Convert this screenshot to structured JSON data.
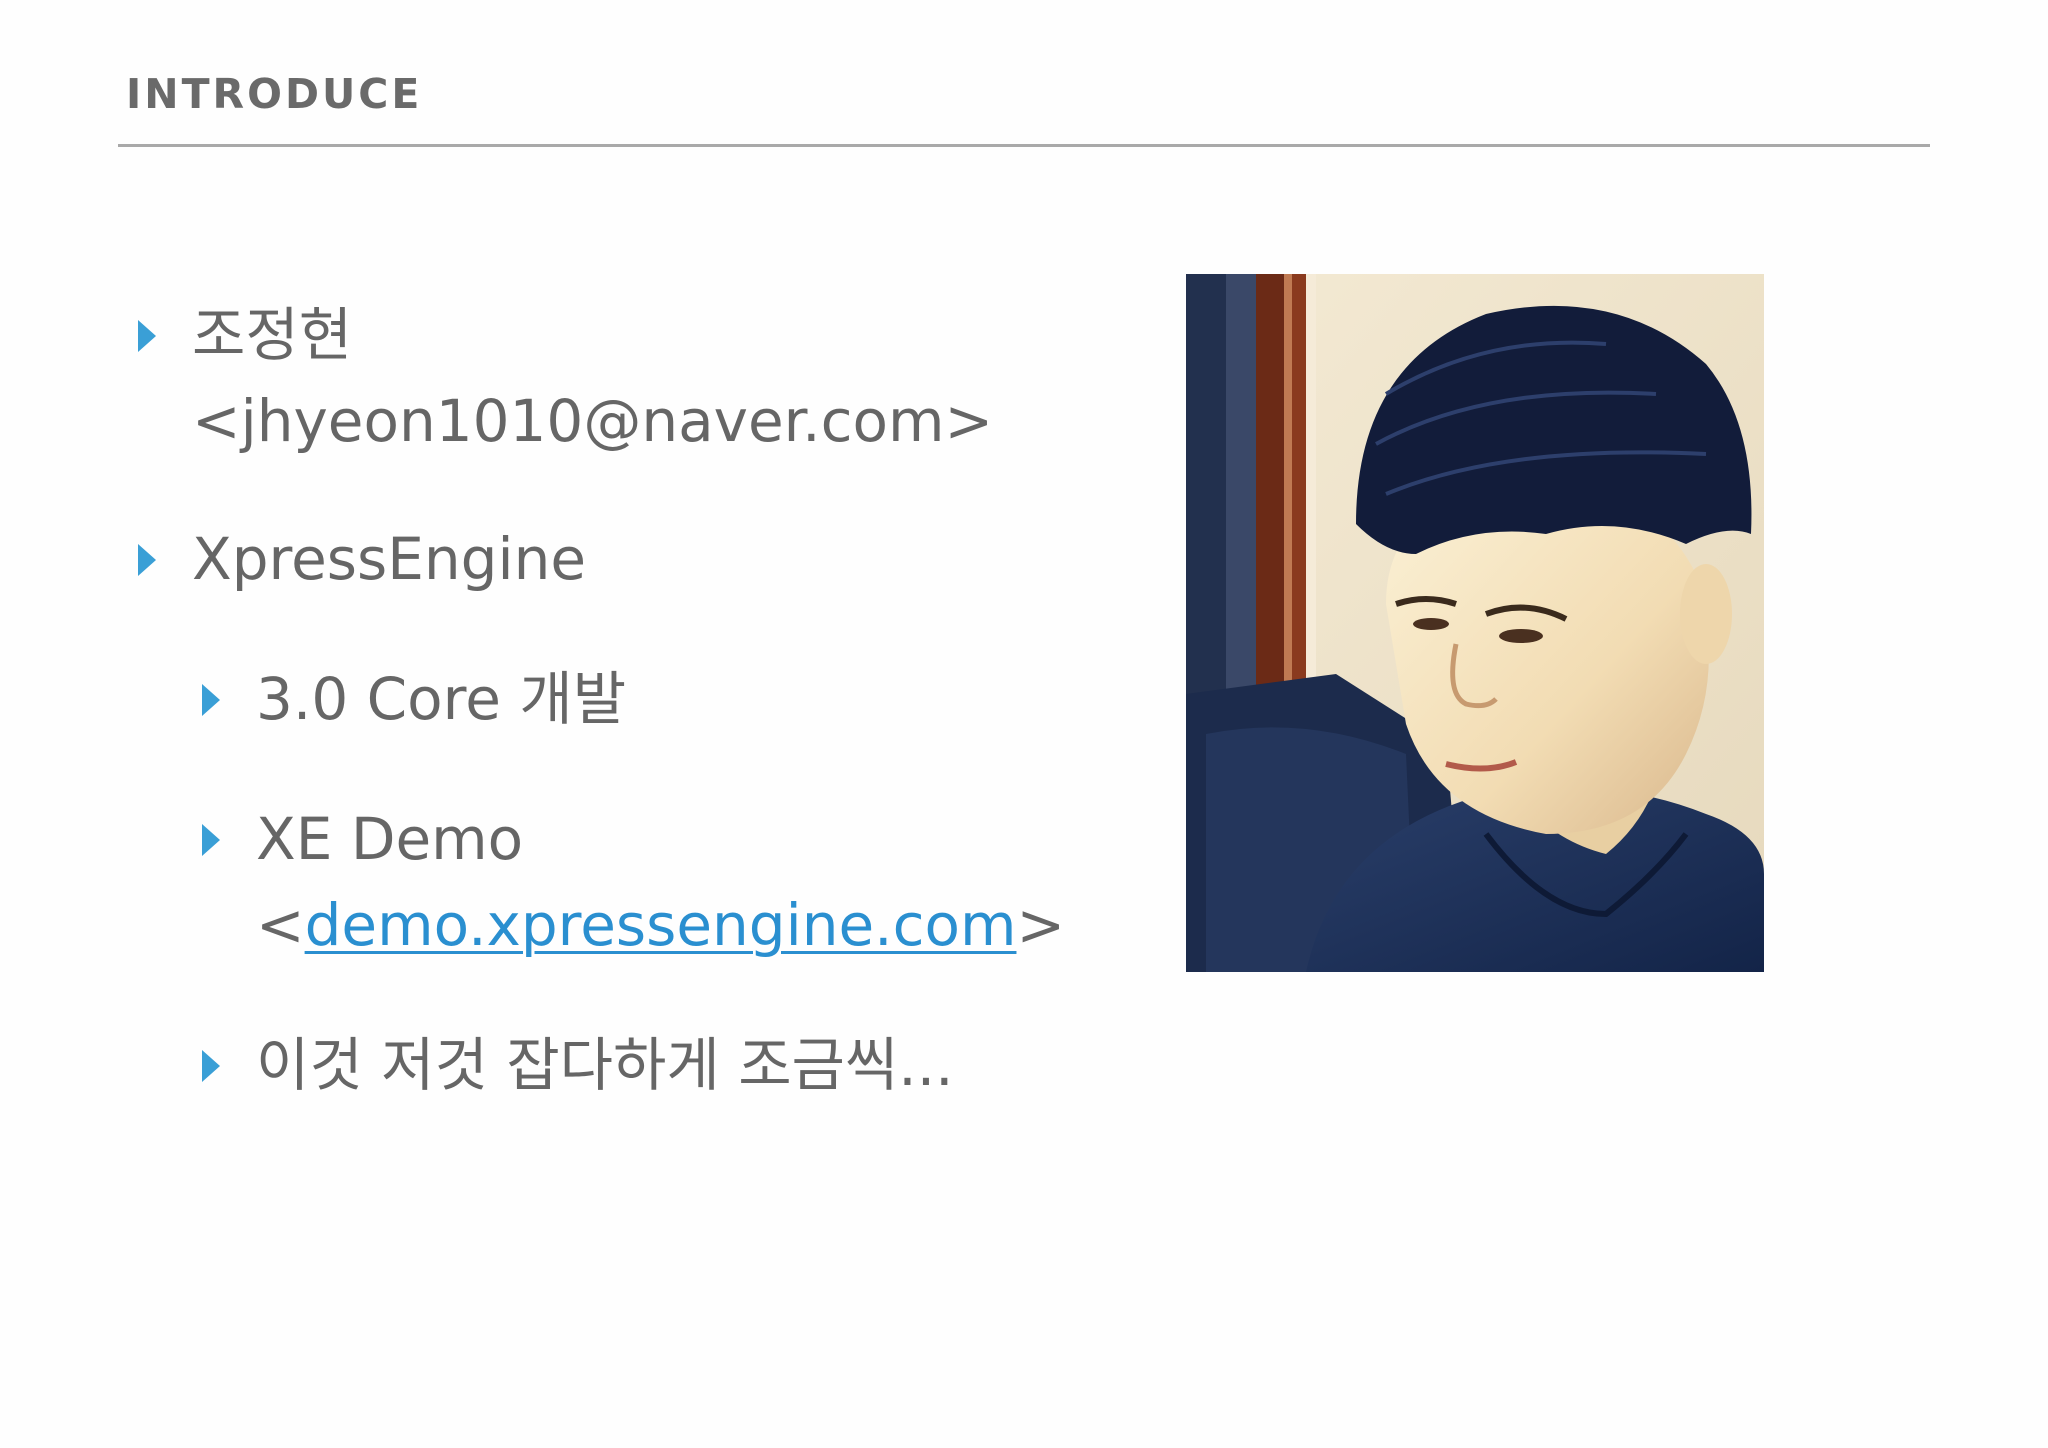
{
  "slide": {
    "header": "INTRODUCE",
    "bullets": [
      {
        "lines": [
          "조정현",
          "<jhyeon1010@naver.com>"
        ]
      },
      {
        "lines": [
          "XpressEngine"
        ]
      }
    ],
    "sub_bullets": [
      {
        "lines": [
          "3.0 Core 개발"
        ]
      },
      {
        "line1": "XE Demo",
        "prefix": "<",
        "link": "demo.xpressengine.com",
        "suffix": ">"
      },
      {
        "lines": [
          "이것 저것 잡다하게 조금씩..."
        ]
      }
    ],
    "colors": {
      "accent": "#3a9fd6",
      "link": "#2a8fd0",
      "text": "#666666",
      "rule": "#a9a9a9"
    },
    "icons": {
      "bullet_marker": "triangle-right-icon"
    }
  }
}
